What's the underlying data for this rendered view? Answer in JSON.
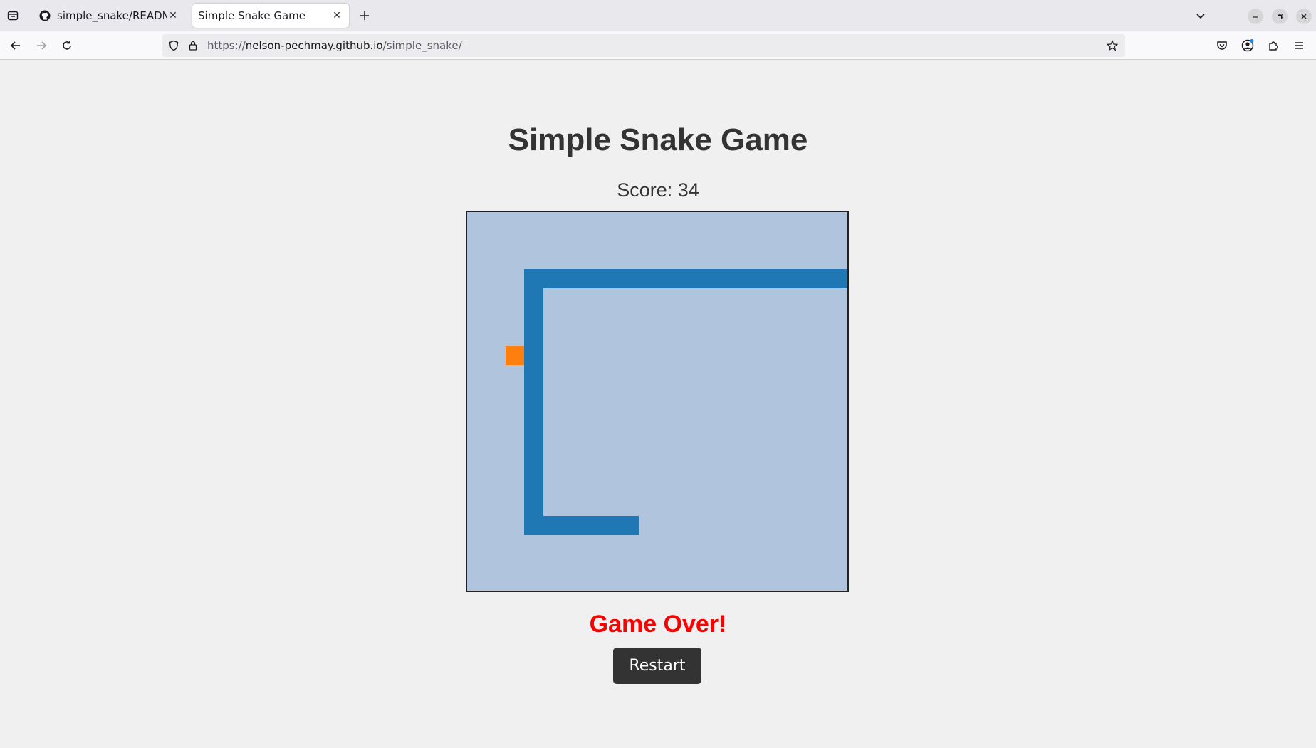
{
  "browser": {
    "tabs": [
      {
        "title": "simple_snake/README.m",
        "icon": "github-icon",
        "active": false
      },
      {
        "title": "Simple Snake Game",
        "icon": "none",
        "active": true
      }
    ],
    "url_scheme": "https://",
    "url_host": "nelson-pechmay.github.io",
    "url_path": "/simple_snake/"
  },
  "game": {
    "title": "Simple Snake Game",
    "score_label": "Score:",
    "score_value": "34",
    "status_text": "Game Over!",
    "restart_label": "Restart",
    "colors": {
      "board": "#b0c4de",
      "snake": "#1f77b4",
      "food": "#ff7f0e",
      "game_over": "#ff0000",
      "button": "#333333"
    }
  }
}
